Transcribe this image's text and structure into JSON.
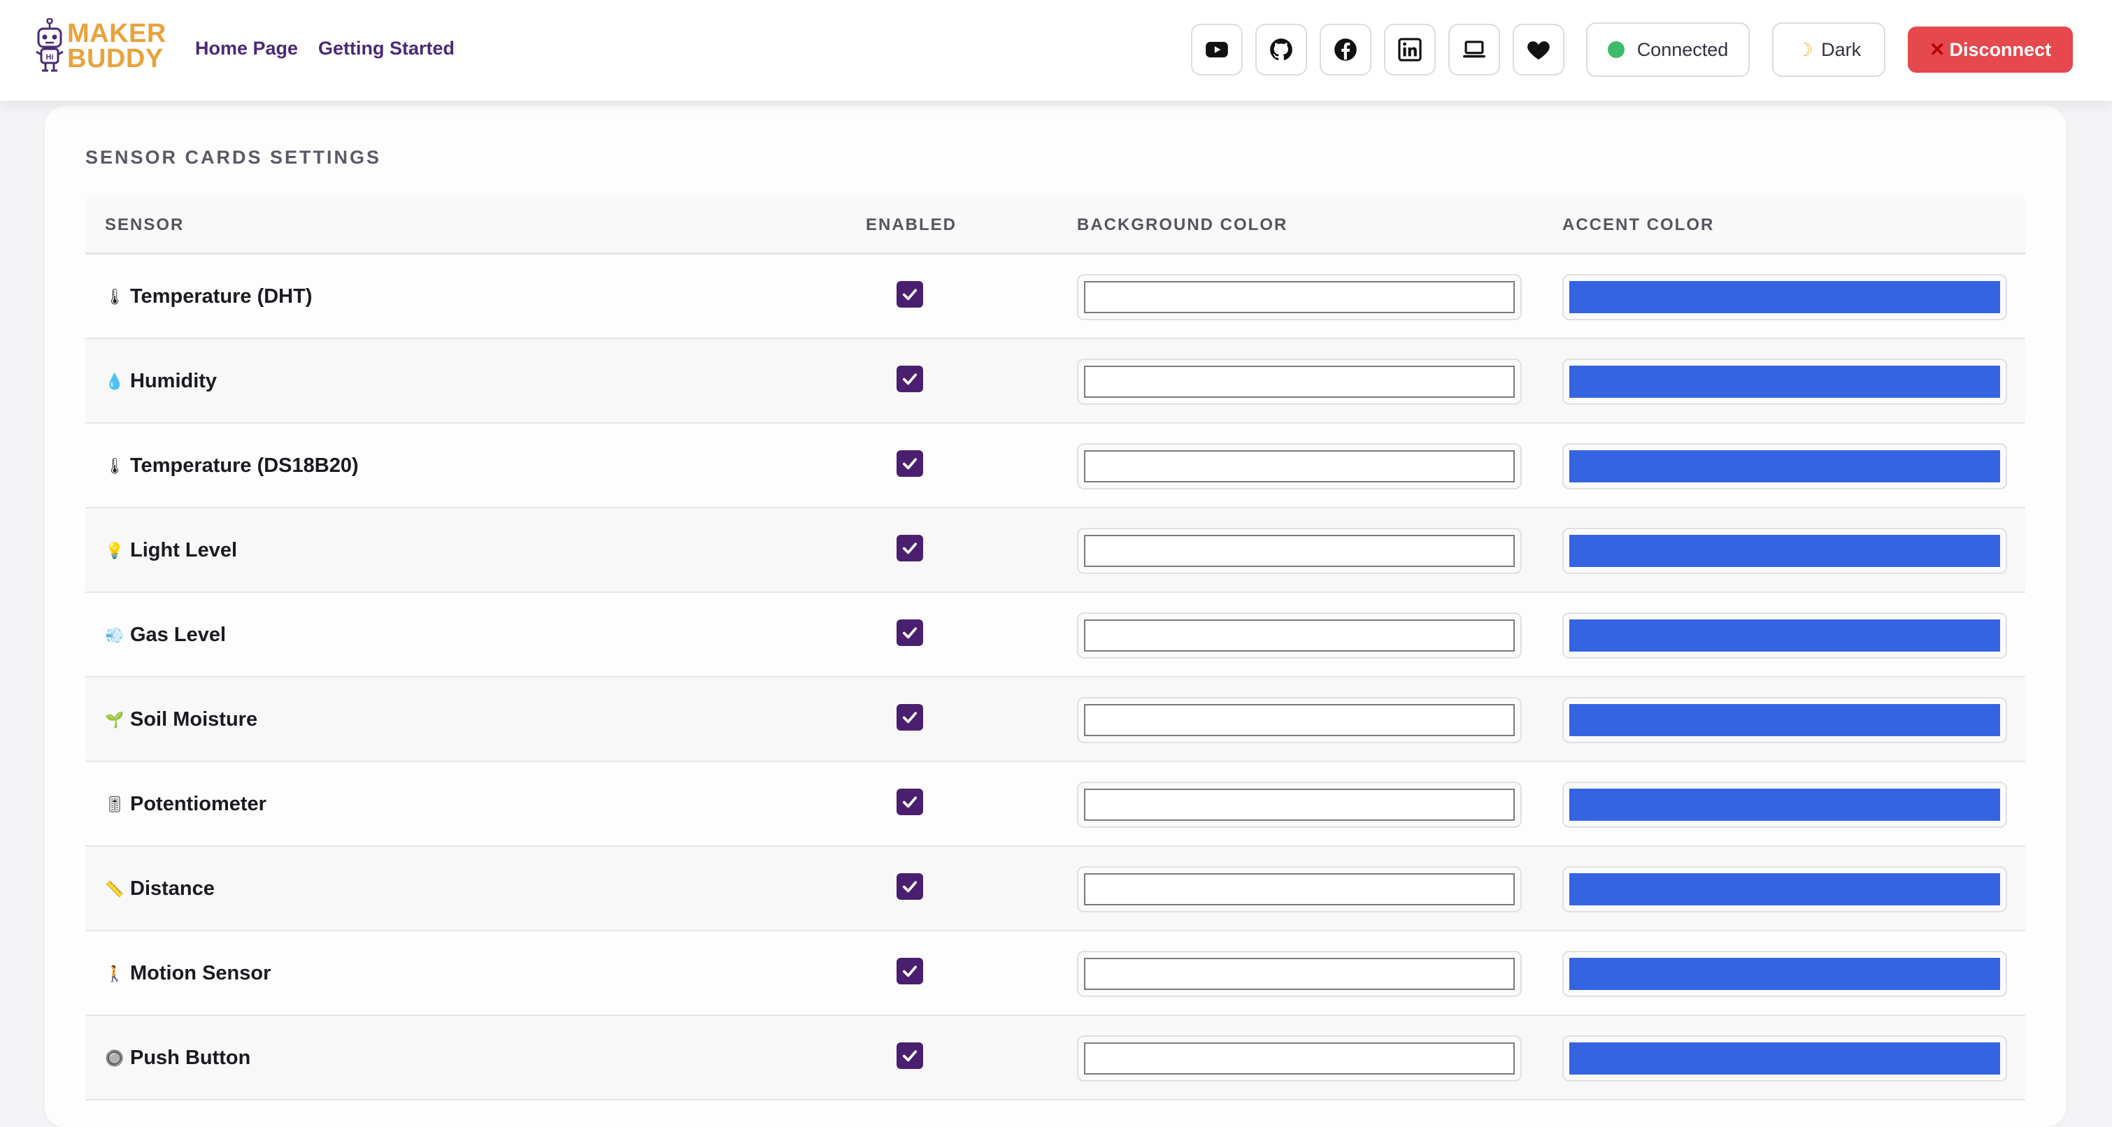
{
  "header": {
    "logo": {
      "line1": "MAKER",
      "line2": "BUDDY"
    },
    "nav": [
      {
        "label": "Home Page"
      },
      {
        "label": "Getting Started"
      }
    ],
    "social_icons": [
      "youtube-icon",
      "github-icon",
      "facebook-icon",
      "linkedin-icon",
      "laptop-icon",
      "heart-icon"
    ],
    "status": {
      "label": "Connected",
      "color": "#3cbc6a"
    },
    "theme": {
      "label": "Dark",
      "icon": "moon-icon"
    },
    "disconnect": {
      "label": "Disconnect",
      "icon": "x-icon",
      "color": "#e5484d"
    }
  },
  "settings": {
    "title": "SENSOR CARDS SETTINGS",
    "columns": {
      "sensor": "SENSOR",
      "enabled": "ENABLED",
      "background": "BACKGROUND COLOR",
      "accent": "ACCENT COLOR"
    },
    "rows": [
      {
        "icon": "🌡",
        "name": "Temperature (DHT)",
        "enabled": true,
        "background": "#ffffff",
        "accent": "#3564e3"
      },
      {
        "icon": "💧",
        "name": "Humidity",
        "enabled": true,
        "background": "#ffffff",
        "accent": "#3564e3"
      },
      {
        "icon": "🌡",
        "name": "Temperature (DS18B20)",
        "enabled": true,
        "background": "#ffffff",
        "accent": "#3564e3"
      },
      {
        "icon": "💡",
        "name": "Light Level",
        "enabled": true,
        "background": "#ffffff",
        "accent": "#3564e3"
      },
      {
        "icon": "💨",
        "name": "Gas Level",
        "enabled": true,
        "background": "#ffffff",
        "accent": "#3564e3"
      },
      {
        "icon": "🌱",
        "name": "Soil Moisture",
        "enabled": true,
        "background": "#ffffff",
        "accent": "#3564e3"
      },
      {
        "icon": "🎚",
        "name": "Potentiometer",
        "enabled": true,
        "background": "#ffffff",
        "accent": "#3564e3"
      },
      {
        "icon": "📏",
        "name": "Distance",
        "enabled": true,
        "background": "#ffffff",
        "accent": "#3564e3"
      },
      {
        "icon": "🚶",
        "name": "Motion Sensor",
        "enabled": true,
        "background": "#ffffff",
        "accent": "#3564e3"
      },
      {
        "icon": "🔘",
        "name": "Push Button",
        "enabled": true,
        "background": "#ffffff",
        "accent": "#3564e3"
      }
    ]
  }
}
